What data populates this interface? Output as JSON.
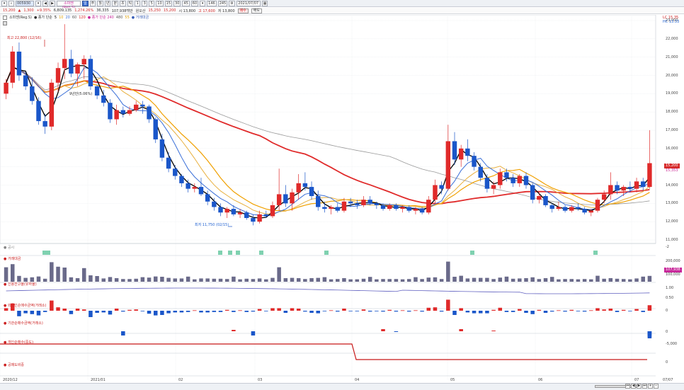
{
  "toolbar": {
    "code": "005930",
    "name": "소마젠(Reg.S)",
    "periods": [
      "1",
      "3",
      "5",
      "10",
      "15",
      "30",
      "45",
      "60"
    ],
    "count": "146",
    "total": "245",
    "date": "2021/07/07",
    "buttons": [
      "일",
      "주",
      "월",
      "년",
      "분",
      "초",
      "틱"
    ]
  },
  "pricebar": {
    "price": "15,200",
    "change": "1,300",
    "change_pct": "+9.35%",
    "volume": "6,809,135",
    "rate": "1,274.26%",
    "amount": "36,335",
    "amount_label": "107,938백만",
    "market": "원오산",
    "open_lbl": "15,250",
    "high_lbl": "15,200",
    "low": "시 13,800",
    "high": "고 17,600",
    "close": "저 13,800",
    "btn_buy": "매수",
    "btn_sell": "매도"
  },
  "legend": {
    "main": "소마젠(Reg.S)",
    "ma_label": "● 종가 단순",
    "ma5": "5",
    "ma10": "10",
    "ma20": "20",
    "ma60": "60",
    "ma120": "120",
    "ma240_label": "● 종가 단순 240",
    "ma480": "480",
    "ma_long": "55",
    "vol_label": "● 거래대금"
  },
  "annotations": {
    "high": "최고 22,800 (12/16)",
    "low": "최저 11,750 (02/15)",
    "mid": "9년만(5.06%)",
    "top_right_1": "LC 15.35",
    "top_right_2": "HC 13.33"
  },
  "sub_panels": {
    "news": "● 공시",
    "volume": "● 거래대금",
    "credit": "● 신용잔고율(유하율)",
    "foreign": "● 외국인순매수금액(거래소)",
    "institution": "● 기관순매수금액(거래소)",
    "individual": "● 개인순매수(중도)",
    "program": "● 공매도비중"
  },
  "price_axis": [
    "23,000",
    "22,000",
    "21,000",
    "20,000",
    "19,000",
    "18,000",
    "17,000",
    "16,000",
    "15,000",
    "14,000",
    "13,000",
    "12,000",
    "11,000"
  ],
  "sub_axis": {
    "news": "-2",
    "volume_top": "200,000",
    "volume_mid": "100,000",
    "credit": "1.00",
    "credit_low": "0.50",
    "foreign": "0",
    "institution": "0",
    "individual": "-5,000",
    "program": "0"
  },
  "tags": {
    "price": "15,200",
    "ma": "15,353",
    "vol": "107,938"
  },
  "dates": [
    "2020/12",
    "2021/01",
    "02",
    "03",
    "04",
    "05",
    "06",
    "07",
    "07/07"
  ],
  "chart_data": {
    "type": "candlestick",
    "candles": [
      [
        19.0,
        19.8,
        18.7,
        19.6
      ],
      [
        19.6,
        21.6,
        19.3,
        21.3
      ],
      [
        21.3,
        21.8,
        19.7,
        20.0
      ],
      [
        20.0,
        20.2,
        19.2,
        19.4
      ],
      [
        19.4,
        19.9,
        18.4,
        18.6
      ],
      [
        18.6,
        18.8,
        17.3,
        17.5
      ],
      [
        17.5,
        17.9,
        16.8,
        17.2
      ],
      [
        17.2,
        19.8,
        17.0,
        19.6
      ],
      [
        19.6,
        20.7,
        19.1,
        20.4
      ],
      [
        20.4,
        22.8,
        19.8,
        20.9
      ],
      [
        20.9,
        21.4,
        19.9,
        20.1
      ],
      [
        20.1,
        20.7,
        19.4,
        20.6
      ],
      [
        20.6,
        21.1,
        19.8,
        20.9
      ],
      [
        20.9,
        21.1,
        19.2,
        19.4
      ],
      [
        19.4,
        19.5,
        18.7,
        18.9
      ],
      [
        18.9,
        19.2,
        18.3,
        18.5
      ],
      [
        18.5,
        18.7,
        17.4,
        17.6
      ],
      [
        17.6,
        18.4,
        17.3,
        18.1
      ],
      [
        18.1,
        18.3,
        17.7,
        17.9
      ],
      [
        17.9,
        18.3,
        17.8,
        18.1
      ],
      [
        18.1,
        18.6,
        18.0,
        18.4
      ],
      [
        18.4,
        18.6,
        17.9,
        18.3
      ],
      [
        18.3,
        18.4,
        17.4,
        17.6
      ],
      [
        17.6,
        17.7,
        16.3,
        16.5
      ],
      [
        16.5,
        16.8,
        15.3,
        15.5
      ],
      [
        15.5,
        15.8,
        14.7,
        14.9
      ],
      [
        14.9,
        15.1,
        14.3,
        14.5
      ],
      [
        14.5,
        14.6,
        13.9,
        14.1
      ],
      [
        14.1,
        14.3,
        13.6,
        13.8
      ],
      [
        13.8,
        14.1,
        13.6,
        13.9
      ],
      [
        13.9,
        14.4,
        13.4,
        13.5
      ],
      [
        13.5,
        13.7,
        12.9,
        13.1
      ],
      [
        13.1,
        13.3,
        12.6,
        12.8
      ],
      [
        12.8,
        13.0,
        12.3,
        12.5
      ],
      [
        12.5,
        12.8,
        12.2,
        12.7
      ],
      [
        12.7,
        12.9,
        12.3,
        12.4
      ],
      [
        12.4,
        12.7,
        12.2,
        12.5
      ],
      [
        12.5,
        12.6,
        12.1,
        12.2
      ],
      [
        12.2,
        12.4,
        11.8,
        12.0
      ],
      [
        12.0,
        12.6,
        11.9,
        12.4
      ],
      [
        12.4,
        12.6,
        12.2,
        12.3
      ],
      [
        12.3,
        13.1,
        12.2,
        12.9
      ],
      [
        12.9,
        14.9,
        12.6,
        13.5
      ],
      [
        13.5,
        14.0,
        12.8,
        13.0
      ],
      [
        13.0,
        13.8,
        12.6,
        13.6
      ],
      [
        13.6,
        14.6,
        13.2,
        14.1
      ],
      [
        14.1,
        14.7,
        13.7,
        13.9
      ],
      [
        13.9,
        14.2,
        13.2,
        13.4
      ],
      [
        13.4,
        13.7,
        12.6,
        12.8
      ],
      [
        12.8,
        13.1,
        12.5,
        12.7
      ],
      [
        12.7,
        12.9,
        12.4,
        12.8
      ],
      [
        12.8,
        13.0,
        12.5,
        12.6
      ],
      [
        12.6,
        13.3,
        12.5,
        13.1
      ],
      [
        13.1,
        13.3,
        12.8,
        13.0
      ],
      [
        13.0,
        13.2,
        12.7,
        12.9
      ],
      [
        12.9,
        13.4,
        12.8,
        13.2
      ],
      [
        13.2,
        13.4,
        12.9,
        13.0
      ],
      [
        13.0,
        13.1,
        12.7,
        12.9
      ],
      [
        12.9,
        13.0,
        12.6,
        12.7
      ],
      [
        12.7,
        13.0,
        12.6,
        12.9
      ],
      [
        12.9,
        13.0,
        12.6,
        12.7
      ],
      [
        12.7,
        12.9,
        12.5,
        12.8
      ],
      [
        12.8,
        12.9,
        12.5,
        12.6
      ],
      [
        12.6,
        12.8,
        12.4,
        12.7
      ],
      [
        12.7,
        12.8,
        12.4,
        12.5
      ],
      [
        12.5,
        13.4,
        12.4,
        13.2
      ],
      [
        13.2,
        14.3,
        13.0,
        14.0
      ],
      [
        14.0,
        14.2,
        13.5,
        13.8
      ],
      [
        13.8,
        17.3,
        13.7,
        16.4
      ],
      [
        16.4,
        16.9,
        15.1,
        15.4
      ],
      [
        15.4,
        16.2,
        15.0,
        16.0
      ],
      [
        16.0,
        16.5,
        15.3,
        15.6
      ],
      [
        15.6,
        15.8,
        14.8,
        15.0
      ],
      [
        15.0,
        15.2,
        14.2,
        14.4
      ],
      [
        14.4,
        14.6,
        13.6,
        13.8
      ],
      [
        13.8,
        14.2,
        13.5,
        14.0
      ],
      [
        14.0,
        14.9,
        13.8,
        14.7
      ],
      [
        14.7,
        14.9,
        14.2,
        14.4
      ],
      [
        14.4,
        14.6,
        13.9,
        14.1
      ],
      [
        14.1,
        14.6,
        13.9,
        14.5
      ],
      [
        14.5,
        14.7,
        13.8,
        14.0
      ],
      [
        14.0,
        14.1,
        13.0,
        13.2
      ],
      [
        13.2,
        13.6,
        13.0,
        13.4
      ],
      [
        13.4,
        13.5,
        12.8,
        12.9
      ],
      [
        12.9,
        13.0,
        12.5,
        12.7
      ],
      [
        12.7,
        13.1,
        12.6,
        12.8
      ],
      [
        12.8,
        12.9,
        12.5,
        12.6
      ],
      [
        12.6,
        12.9,
        12.5,
        12.8
      ],
      [
        12.8,
        13.0,
        12.6,
        12.7
      ],
      [
        12.7,
        12.8,
        12.4,
        12.5
      ],
      [
        12.5,
        12.7,
        12.3,
        12.6
      ],
      [
        12.6,
        13.3,
        12.5,
        13.2
      ],
      [
        13.2,
        13.7,
        13.0,
        13.5
      ],
      [
        13.5,
        14.7,
        13.2,
        14.0
      ],
      [
        14.0,
        14.2,
        13.5,
        13.7
      ],
      [
        13.7,
        14.0,
        13.4,
        13.9
      ],
      [
        13.9,
        14.2,
        13.6,
        13.8
      ],
      [
        13.8,
        14.4,
        13.6,
        14.2
      ],
      [
        14.2,
        14.4,
        13.7,
        13.9
      ],
      [
        13.9,
        17.0,
        13.8,
        15.2
      ]
    ],
    "ylim": [
      11,
      23
    ]
  }
}
